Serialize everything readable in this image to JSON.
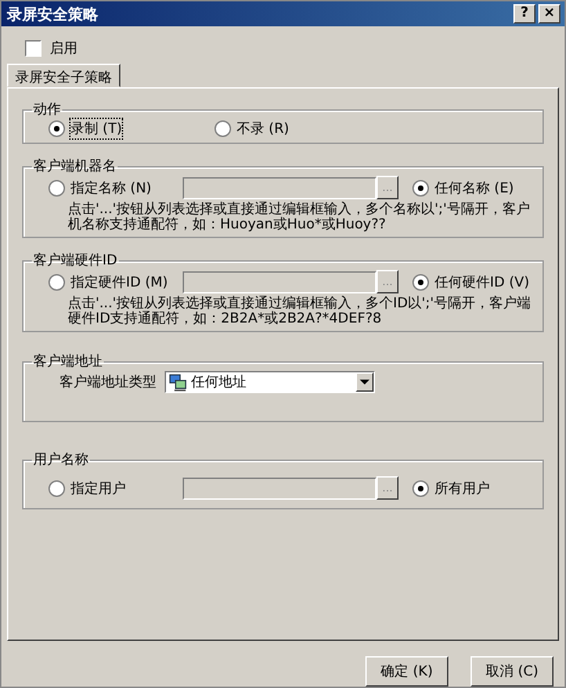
{
  "window": {
    "title": "录屏安全策略",
    "buttons": [
      "?",
      "×"
    ]
  },
  "enable": {
    "label": "启用",
    "checked": false
  },
  "tabs": [
    {
      "label": "录屏安全子策略",
      "selected": true
    }
  ],
  "groups": [
    {
      "kind": "radios",
      "title": "动作",
      "options": [
        {
          "label": "录制 (T)",
          "selected": true
        },
        {
          "label": "不录 (R)",
          "selected": false
        }
      ]
    },
    {
      "kind": "picker",
      "title": "客户端机器名",
      "specific": {
        "label": "指定名称 (N)",
        "selected": false
      },
      "browse": "...",
      "any": {
        "label": "任何名称 (E)",
        "selected": true
      },
      "hint": "点击'...'按钮从列表选择或直接通过编辑框输入，多个名称以';'号隔开，客户机名称支持通配符，如：Huoyan或Huo*或Huoy??"
    },
    {
      "kind": "picker",
      "title": "客户端硬件ID",
      "specific": {
        "label": "指定硬件ID (M)",
        "selected": false
      },
      "browse": "...",
      "any": {
        "label": "任何硬件ID (V)",
        "selected": true
      },
      "hint": "点击'...'按钮从列表选择或直接通过编辑框输入，多个ID以';'号隔开，客户端硬件ID支持通配符，如：2B2A*或2B2A?*4DEF?8"
    },
    {
      "kind": "dropdown",
      "title": "客户端地址",
      "label": "客户端地址类型",
      "value": "任何地址"
    },
    {
      "kind": "picker",
      "title": "用户名称",
      "specific": {
        "label": "指定用户",
        "selected": false
      },
      "browse": "...",
      "any": {
        "label": "所有用户",
        "selected": true
      }
    }
  ],
  "buttons": [
    "确定 (K)",
    "取消 (C)"
  ]
}
